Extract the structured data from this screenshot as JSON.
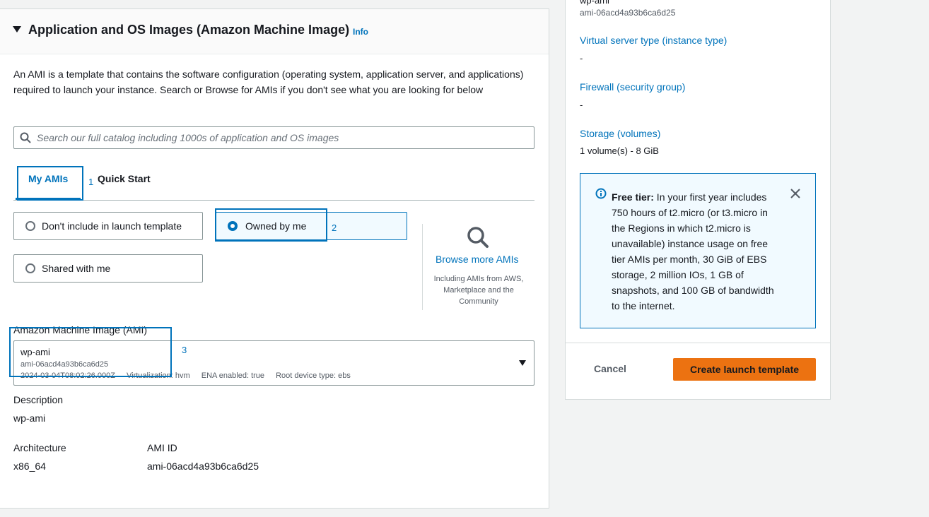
{
  "section": {
    "title": "Application and OS Images (Amazon Machine Image)",
    "info": "Info",
    "intro": "An AMI is a template that contains the software configuration (operating system, application server, and applications) required to launch your instance. Search or Browse for AMIs if you don't see what you are looking for below"
  },
  "search": {
    "placeholder": "Search our full catalog including 1000s of application and OS images"
  },
  "tabs": [
    {
      "label": "My AMIs",
      "selected": true
    },
    {
      "label": "Quick Start",
      "selected": false
    }
  ],
  "annotations": [
    "1",
    "2",
    "3"
  ],
  "radio_options": [
    {
      "label": "Don't include in launch template",
      "selected": false
    },
    {
      "label": "Owned by me",
      "selected": true
    },
    {
      "label": "Shared with me",
      "selected": false
    }
  ],
  "browse": {
    "label": "Browse more AMIs",
    "subtext": "Including AMIs from AWS, Marketplace and the Community"
  },
  "ami": {
    "label": "Amazon Machine Image (AMI)",
    "name": "wp-ami",
    "id": "ami-06acd4a93b6ca6d25",
    "created": "2024-03-04T08:02:26.000Z",
    "virtualization": "Virtualization: hvm",
    "ena": "ENA enabled: true",
    "root_device": "Root device type: ebs"
  },
  "details": {
    "description_label": "Description",
    "description_value": "wp-ami",
    "architecture_label": "Architecture",
    "architecture_value": "x86_64",
    "ami_id_label": "AMI ID",
    "ami_id_value": "ami-06acd4a93b6ca6d25"
  },
  "summary": {
    "top_name": "wp-ami",
    "top_id": "ami-06acd4a93b6ca6d25",
    "instance_type_label": "Virtual server type (instance type)",
    "instance_type_value": "-",
    "firewall_label": "Firewall (security group)",
    "firewall_value": "-",
    "storage_label": "Storage (volumes)",
    "storage_value": "1 volume(s) - 8 GiB",
    "free_tier_title": "Free tier:",
    "free_tier_text": " In your first year includes 750 hours of t2.micro (or t3.micro in the Regions in which t2.micro is unavailable) instance usage on free tier AMIs per month, 30 GiB of EBS storage, 2 million IOs, 1 GB of snapshots, and 100 GB of bandwidth to the internet.",
    "cancel": "Cancel",
    "create": "Create launch template"
  },
  "colors": {
    "accent": "#0073bb",
    "primary_button": "#ec7211"
  }
}
